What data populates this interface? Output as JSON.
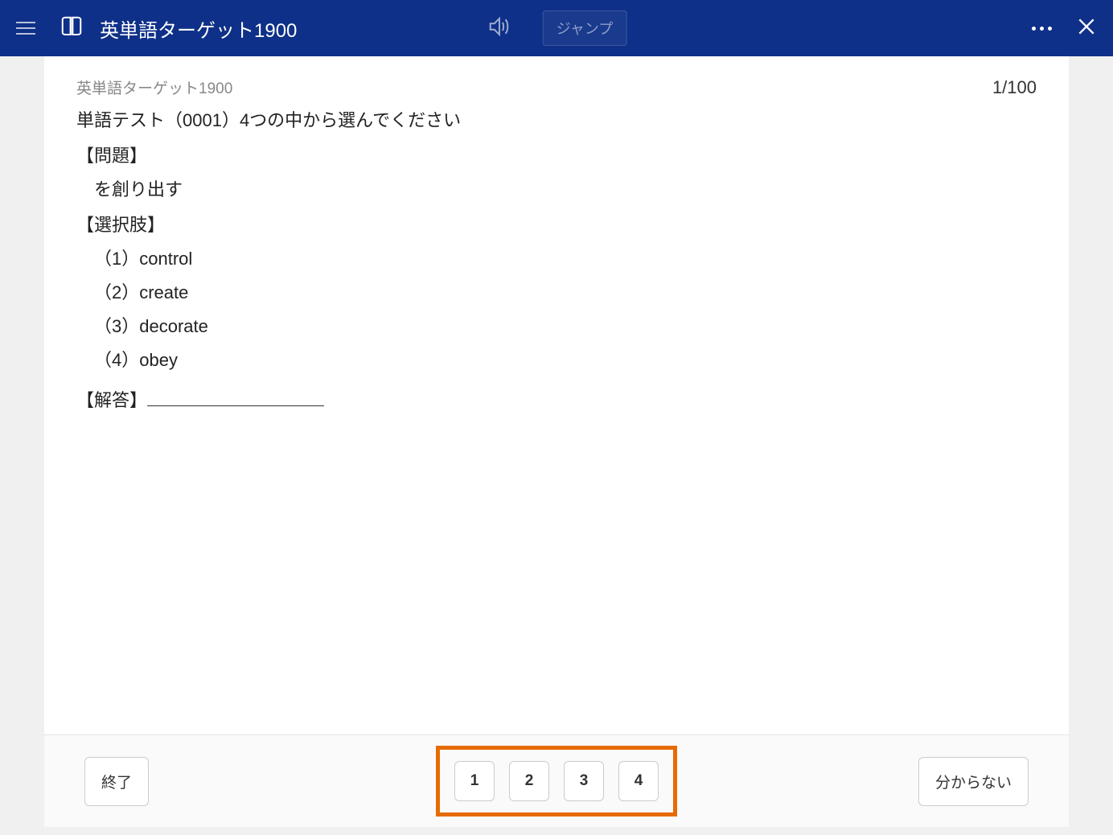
{
  "header": {
    "title": "英単語ターゲット1900",
    "jump_label": "ジャンプ"
  },
  "content": {
    "breadcrumb": "英単語ターゲット1900",
    "page_counter": "1/100",
    "instruction": "単語テスト（0001）4つの中から選んでください",
    "question_label": "【問題】",
    "question_text": "を創り出す",
    "choices_label": "【選択肢】",
    "options": [
      "（1）control",
      "（2）create",
      "（3）decorate",
      "（4）obey"
    ],
    "answer_label": "【解答】"
  },
  "footer": {
    "exit_label": "終了",
    "answer_buttons": [
      "1",
      "2",
      "3",
      "4"
    ],
    "unknown_label": "分からない"
  }
}
